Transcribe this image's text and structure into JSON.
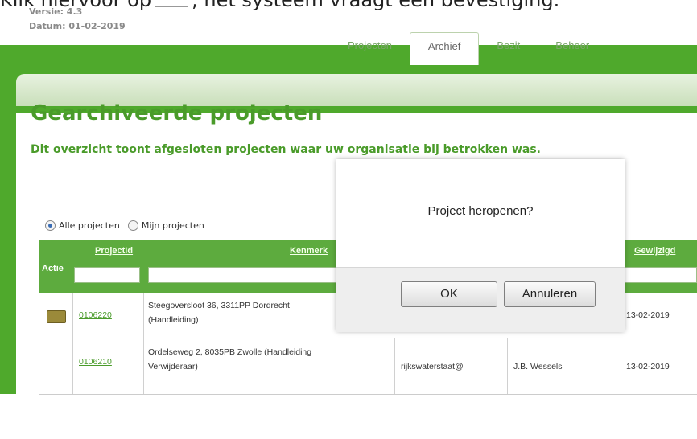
{
  "caption": {
    "before": "Klik hiervoor op",
    "after": ", het systeem vraagt een bevestiging."
  },
  "meta": {
    "version": "Versie: 4.3",
    "date": "Datum: 01-02-2019"
  },
  "tabs": [
    {
      "label": "Projecten",
      "active": false
    },
    {
      "label": "Archief",
      "active": true
    },
    {
      "label": "Bezit",
      "active": false
    },
    {
      "label": "Beheer",
      "active": false
    }
  ],
  "page": {
    "title": "Gearchiveerde projecten",
    "subtitle": "Dit overzicht toont afgesloten projecten waar uw organisatie bij betrokken was."
  },
  "filter": {
    "all_label": "Alle projecten",
    "mine_label": "Mijn projecten",
    "selected": "all"
  },
  "table": {
    "headers": {
      "actie": "Actie",
      "projectid": "ProjectId",
      "kenmerk": "Kenmerk",
      "gewijzigd": "Gewijzigd"
    },
    "rows": [
      {
        "id": "0106220",
        "kenmerk1": "Steegoversloot 36, 3311PP Dordrecht",
        "kenmerk2": "(Handleiding)",
        "org": "",
        "person": "",
        "date": "13-02-2019"
      },
      {
        "id": "0106210",
        "kenmerk1": "Ordelseweg 2, 8035PB Zwolle (Handleiding",
        "kenmerk2": "Verwijderaar)",
        "org": "rijkswaterstaat@",
        "person": "J.B. Wessels",
        "date": "13-02-2019"
      }
    ]
  },
  "dialog": {
    "message": "Project heropenen?",
    "ok": "OK",
    "cancel": "Annuleren"
  },
  "colors": {
    "green": "#4fa92c",
    "title_green": "#4a9b2a"
  }
}
